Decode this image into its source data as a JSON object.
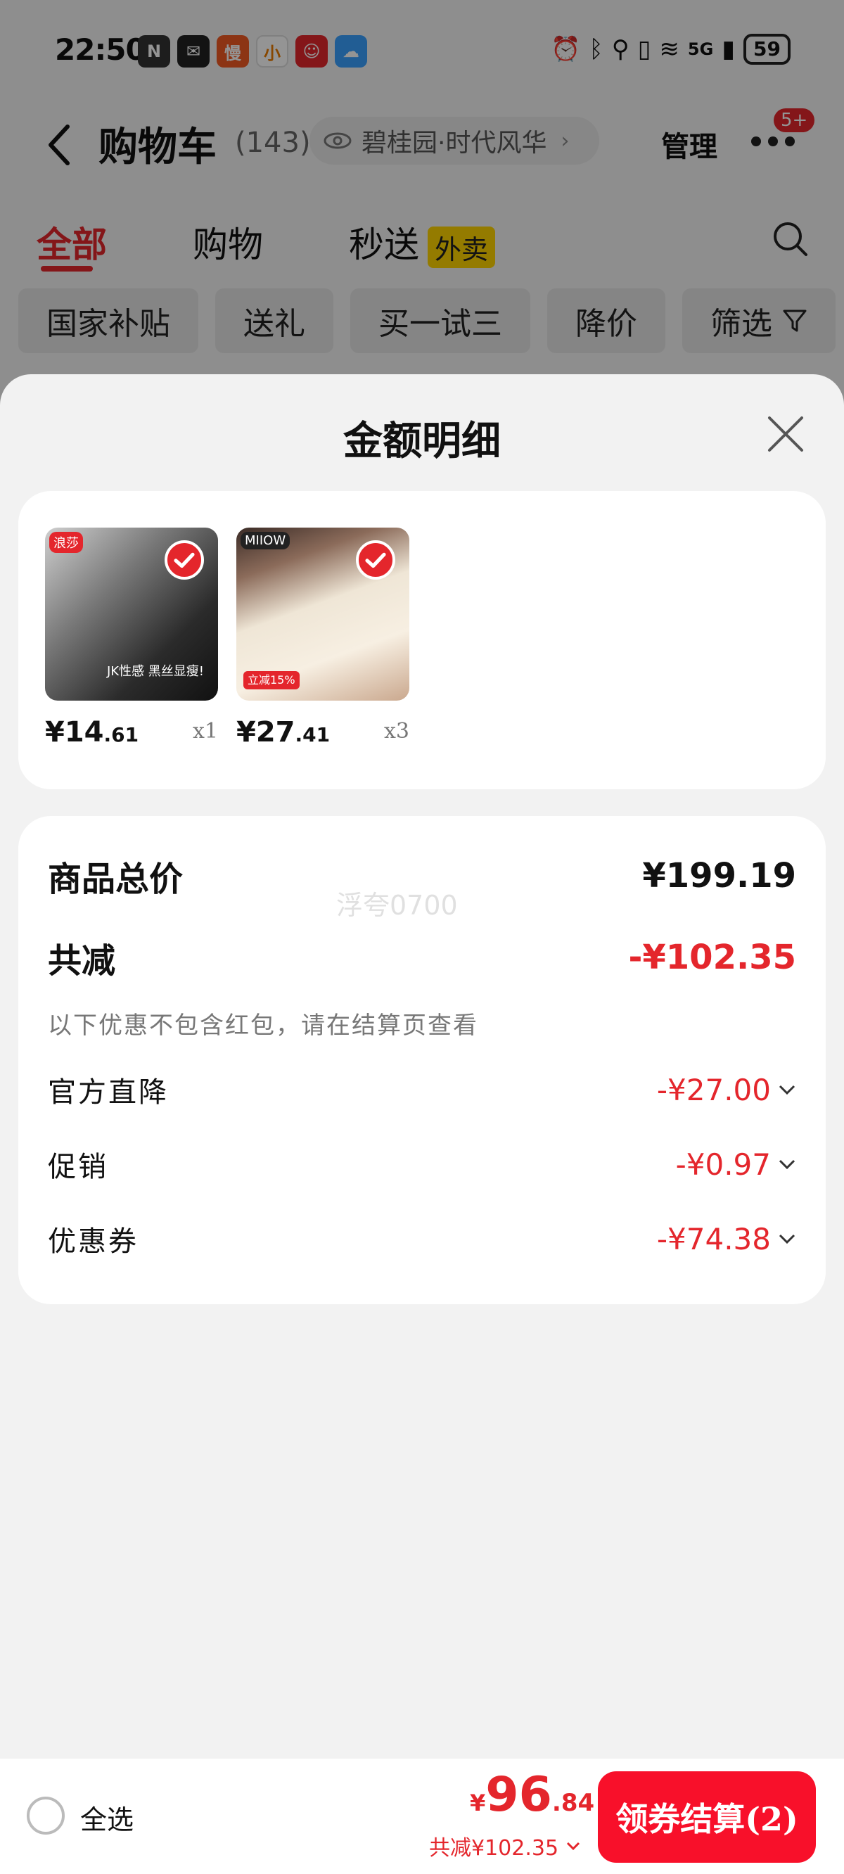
{
  "status_bar": {
    "time": "22:50",
    "battery": "59",
    "network": "5G",
    "app_icons": [
      {
        "name": "nfc-icon",
        "glyph": "N"
      },
      {
        "name": "wechat-icon",
        "glyph": "✉"
      },
      {
        "name": "app-man-icon",
        "glyph": "慢"
      },
      {
        "name": "app-xiaohao-icon",
        "glyph": "小"
      },
      {
        "name": "app-mascot-icon",
        "glyph": "☺"
      },
      {
        "name": "weather-icon",
        "glyph": "☁"
      }
    ]
  },
  "nav": {
    "title": "购物车",
    "count": "(143)",
    "address": "碧桂园·时代风华",
    "manage": "管理",
    "badge": "5+"
  },
  "tabs": {
    "all": "全部",
    "shopping": "购物",
    "seconds": "秒送",
    "seconds_tag": "外卖"
  },
  "chips": [
    "国家补贴",
    "送礼",
    "买一试三",
    "降价",
    "筛选"
  ],
  "sheet": {
    "title": "金额明细",
    "products": [
      {
        "price_int": "¥14",
        "price_dec": ".61",
        "qty": "x1",
        "corner_tag": "浪莎",
        "caption": "JK性感 黑丝显瘦!"
      },
      {
        "price_int": "¥27",
        "price_dec": ".41",
        "qty": "x3",
        "corner_tag": "MIIOW",
        "promo": "立减15%"
      }
    ],
    "summary": {
      "total_label": "商品总价",
      "total_value": "¥199.19",
      "reduce_label": "共减",
      "reduce_value": "-¥102.35",
      "note": "以下优惠不包含红包，请在结算页查看",
      "items": [
        {
          "label": "官方直降",
          "value": "-¥27.00"
        },
        {
          "label": "促销",
          "value": "-¥0.97"
        },
        {
          "label": "优惠券",
          "value": "-¥74.38"
        }
      ],
      "watermark": "浮夸0700"
    }
  },
  "bottom": {
    "select_all": "全选",
    "currency": "¥",
    "total_int": "96",
    "total_dec": ".84",
    "saved": "共减¥102.35",
    "checkout": "领券结算(2)"
  },
  "colors": {
    "accent": "#e4262c",
    "checkout": "#f8102a"
  }
}
